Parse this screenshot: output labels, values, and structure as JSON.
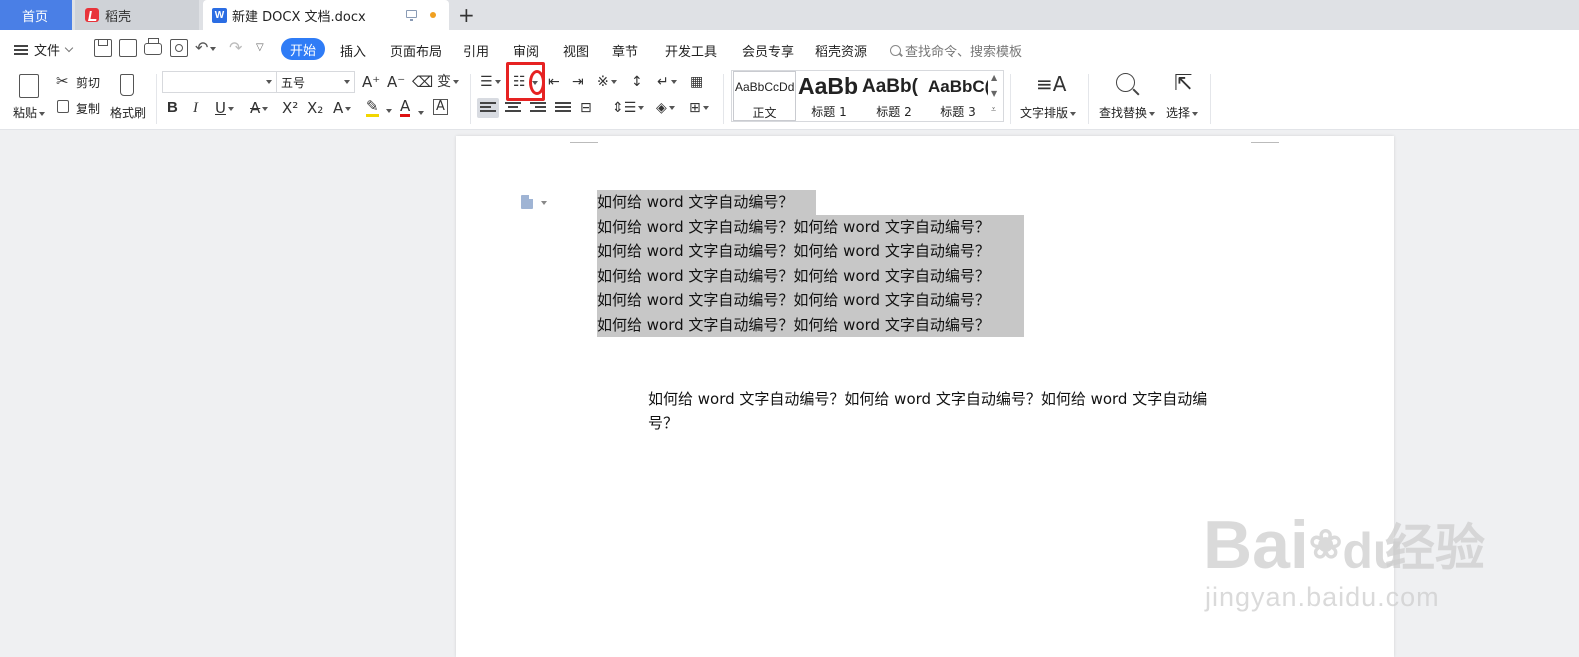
{
  "tabs": {
    "home": "首页",
    "daoke": "稻壳",
    "doc": "新建 DOCX 文档.docx",
    "word_glyph": "W"
  },
  "menu": {
    "file": "文件",
    "items": [
      "开始",
      "插入",
      "页面布局",
      "引用",
      "审阅",
      "视图",
      "章节",
      "开发工具",
      "会员专享",
      "稻壳资源"
    ],
    "search": "查找命令、搜索模板"
  },
  "ribbon": {
    "paste": "粘贴",
    "cut": "剪切",
    "copy": "复制",
    "format_painter": "格式刷",
    "font_name": "",
    "font_size": "五号",
    "styles": [
      {
        "sample": "AaBbCcDd",
        "name": "正文"
      },
      {
        "sample": "AaBb",
        "name": "标题 1"
      },
      {
        "sample": "AaBb(",
        "name": "标题 2"
      },
      {
        "sample": "AaBbC(",
        "name": "标题 3"
      }
    ],
    "text_layout": "文字排版",
    "find_replace": "查找替换",
    "select": "选择"
  },
  "document": {
    "selected_lines": [
      "如何给 word 文字自动编号？",
      "如何给 word 文字自动编号？如何给 word 文字自动编号？",
      "如何给 word 文字自动编号？如何给 word 文字自动编号？",
      "如何给 word 文字自动编号？如何给 word 文字自动编号？",
      "如何给 word 文字自动编号？如何给 word 文字自动编号？",
      "如何给 word 文字自动编号？如何给 word 文字自动编号？"
    ],
    "body_line_1": "如何给 word 文字自动编号？如何给 word 文字自动编号？如何给 word 文字自动编",
    "body_line_2": "号？"
  },
  "watermark": {
    "brand": "Bai",
    "brand2": "du",
    "cn": "经验",
    "url": "jingyan.baidu.com"
  },
  "colors": {
    "accent": "#2f7cf6",
    "highlight": "#e62222",
    "selection": "#c7c7c7"
  }
}
